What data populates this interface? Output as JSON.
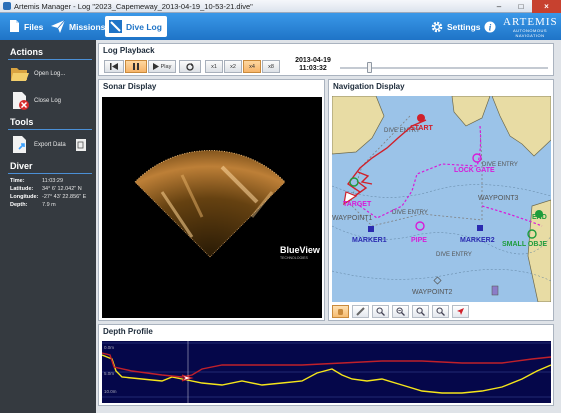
{
  "window": {
    "title": "Artemis Manager - Log \"2023_Capemeway_2013-04-19_10-53-21.dive\"",
    "minimize": "–",
    "maximize": "□",
    "close": "×"
  },
  "toolbar": {
    "files": "Files",
    "missions": "Missions",
    "dive_log": "Dive Log",
    "settings": "Settings",
    "help": "i",
    "logo": "ARTEMIS",
    "logo_sub": "AUTONOMOUS NAVIGATION"
  },
  "sidebar": {
    "actions_title": "Actions",
    "open_log": "Open Log...",
    "close_log": "Close Log",
    "tools_title": "Tools",
    "export_data": "Export Data",
    "diver_title": "Diver",
    "diver": {
      "time_label": "Time:",
      "time": "11:03:29",
      "lat_label": "Latitude:",
      "lat": "34° 6' 12.042\" N",
      "lon_label": "Longitude:",
      "lon": "-27° 43' 22.856\" E",
      "depth_label": "Depth:",
      "depth": "7.9 m"
    }
  },
  "playback": {
    "title": "Log Playback",
    "play": "Play",
    "speeds": [
      "x1",
      "x2",
      "x4",
      "x8"
    ],
    "active_speed": "x4",
    "date": "2013-04-19",
    "time": "11:03:32",
    "slider_position": 0.14
  },
  "sonar": {
    "title": "Sonar Display",
    "brand": "BlueView",
    "brand_sub": "TECHNOLOGIES"
  },
  "navigation": {
    "title": "Navigation Display",
    "waypoints": [
      "START",
      "LOCK GATE",
      "TARGET",
      "WAYPOINT1",
      "MARKER1",
      "PIPE",
      "MARKER2",
      "WAYPOINT3",
      "END",
      "SMALL OBJE",
      "WAYPOINT2"
    ],
    "chart_labels": [
      "DIVE ENTRY",
      "DIVE ENTRY",
      "DIVE ENTRY",
      "DIVE ENTRY"
    ]
  },
  "depth": {
    "title": "Depth Profile",
    "scale_top": "0.0m",
    "scale_mid": "5.0m",
    "scale_bottom": "10.0m"
  },
  "colors": {
    "accent": "#1f74c7",
    "sidebar": "#353a40",
    "close_button": "#c7412f",
    "track": "#d0202a",
    "waypoint": "#d81bd8",
    "depth_line": "#f5e51a"
  }
}
